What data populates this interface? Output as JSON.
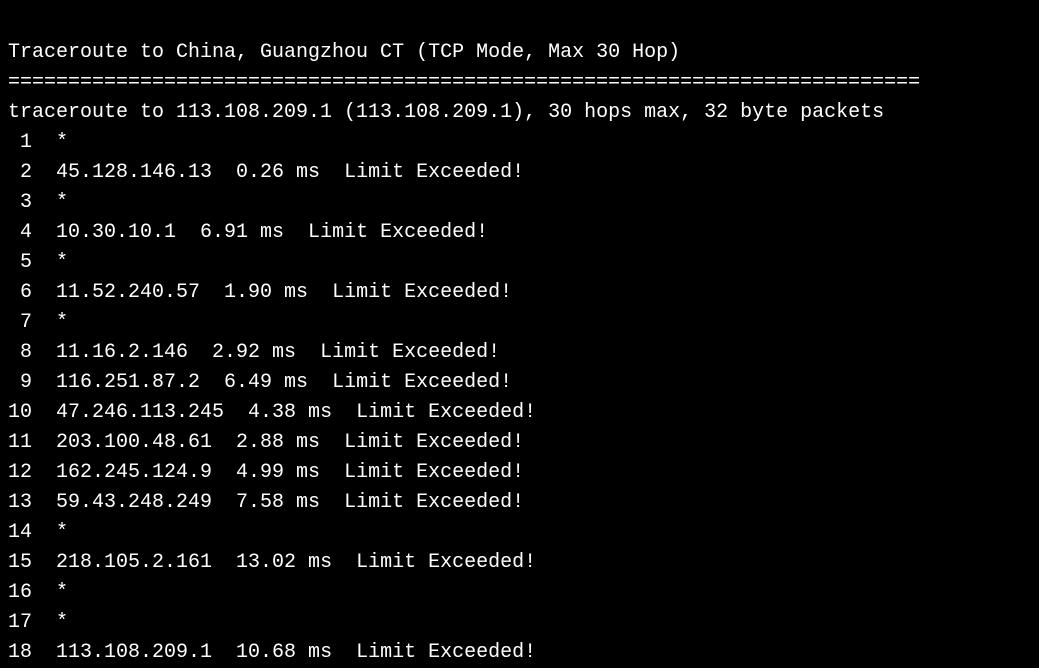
{
  "header": {
    "title": "Traceroute to China, Guangzhou CT (TCP Mode, Max 30 Hop)",
    "divider": "============================================================================",
    "info": "traceroute to 113.108.209.1 (113.108.209.1), 30 hops max, 32 byte packets"
  },
  "hops": [
    {
      "num": " 1",
      "rest": "  *"
    },
    {
      "num": " 2",
      "rest": "  45.128.146.13  0.26 ms  Limit Exceeded!"
    },
    {
      "num": " 3",
      "rest": "  *"
    },
    {
      "num": " 4",
      "rest": "  10.30.10.1  6.91 ms  Limit Exceeded!"
    },
    {
      "num": " 5",
      "rest": "  *"
    },
    {
      "num": " 6",
      "rest": "  11.52.240.57  1.90 ms  Limit Exceeded!"
    },
    {
      "num": " 7",
      "rest": "  *"
    },
    {
      "num": " 8",
      "rest": "  11.16.2.146  2.92 ms  Limit Exceeded!"
    },
    {
      "num": " 9",
      "rest": "  116.251.87.2  6.49 ms  Limit Exceeded!"
    },
    {
      "num": "10",
      "rest": "  47.246.113.245  4.38 ms  Limit Exceeded!"
    },
    {
      "num": "11",
      "rest": "  203.100.48.61  2.88 ms  Limit Exceeded!"
    },
    {
      "num": "12",
      "rest": "  162.245.124.9  4.99 ms  Limit Exceeded!"
    },
    {
      "num": "13",
      "rest": "  59.43.248.249  7.58 ms  Limit Exceeded!"
    },
    {
      "num": "14",
      "rest": "  *"
    },
    {
      "num": "15",
      "rest": "  218.105.2.161  13.02 ms  Limit Exceeded!"
    },
    {
      "num": "16",
      "rest": "  *"
    },
    {
      "num": "17",
      "rest": "  *"
    },
    {
      "num": "18",
      "rest": "  113.108.209.1  10.68 ms  Limit Exceeded!"
    }
  ]
}
